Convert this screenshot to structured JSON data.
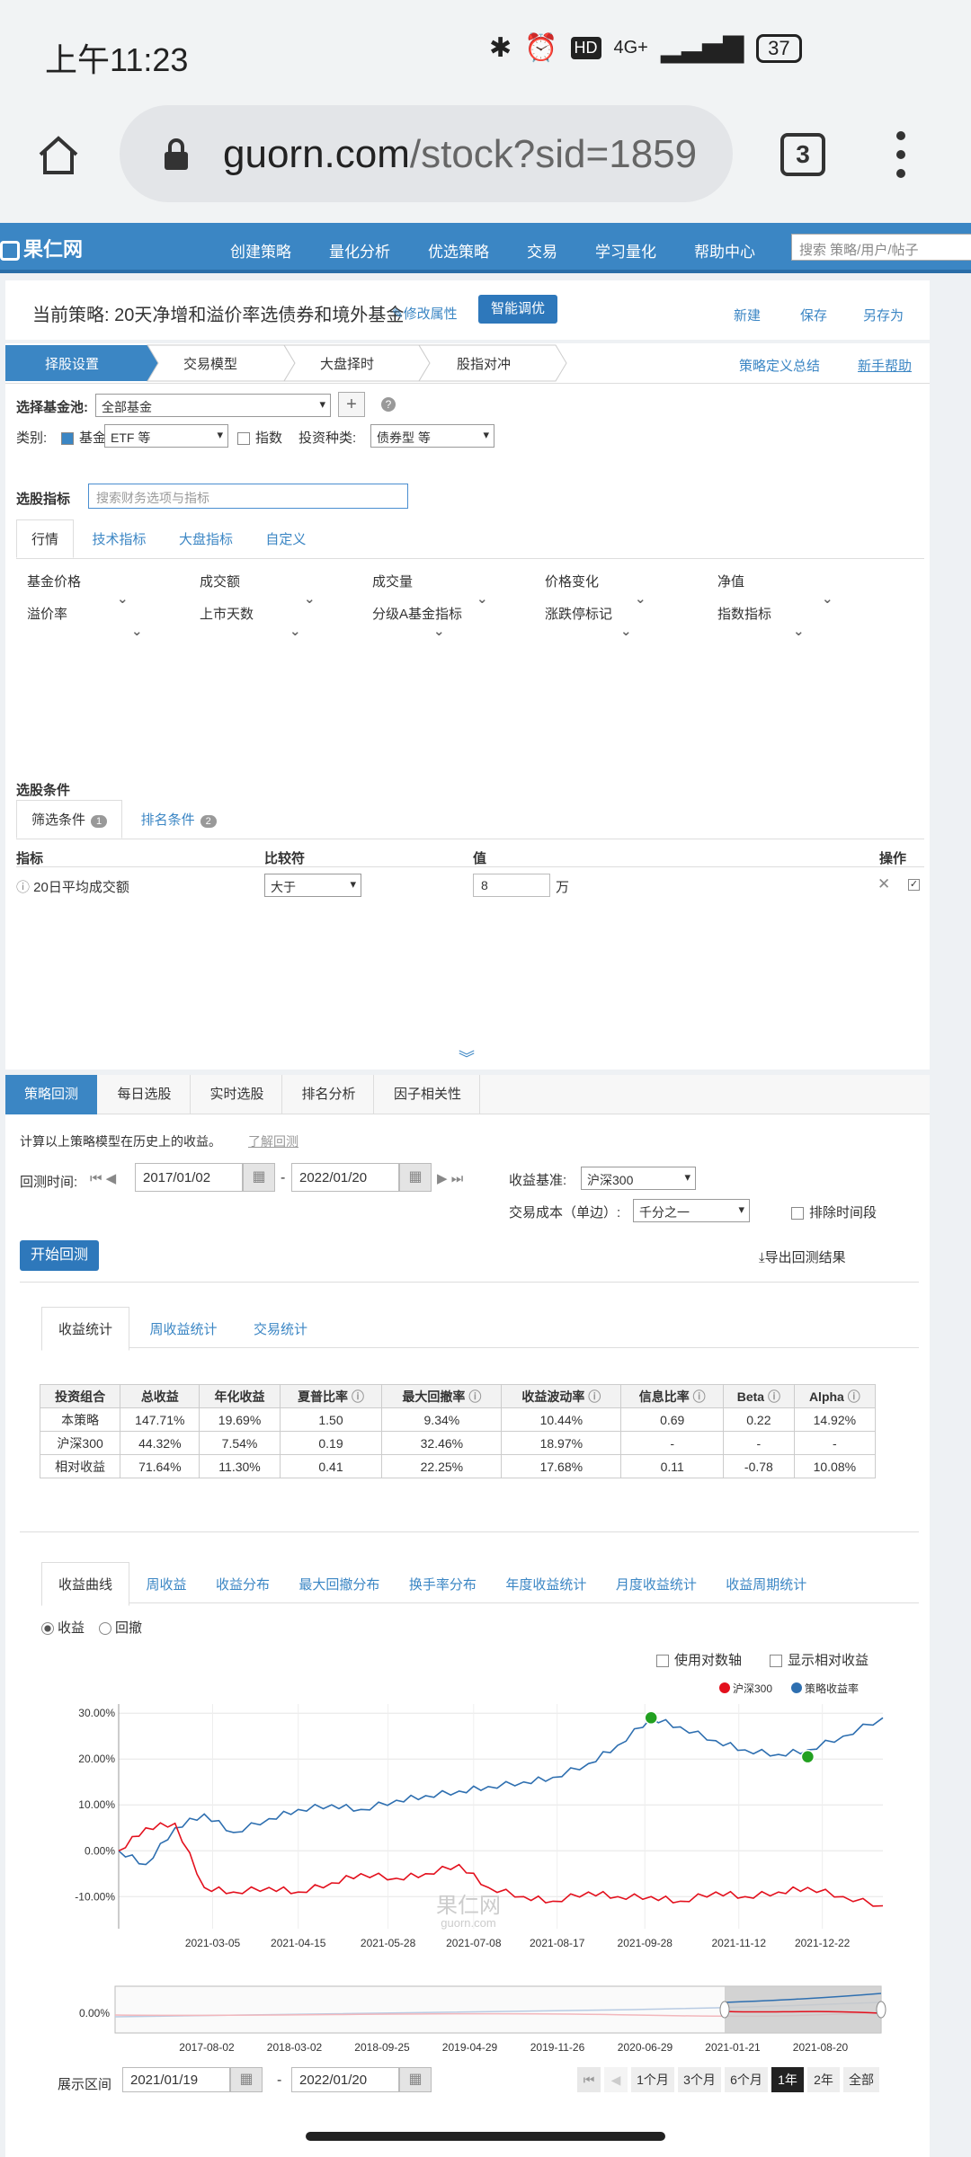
{
  "status_bar": {
    "time": "上午11:23",
    "network": "4G+",
    "battery": "37"
  },
  "browser": {
    "url_main": "guorn.com",
    "url_path": "/stock?sid=1859",
    "tab_count": "3"
  },
  "site": {
    "logo": "果仁网",
    "menu": [
      "创建策略",
      "量化分析",
      "优选策略",
      "交易",
      "学习量化",
      "帮助中心"
    ],
    "search_placeholder": "搜索 策略/用户/帖子"
  },
  "strategy": {
    "title": "当前策略: 20天净增和溢价率选债券和境外基金",
    "edit_label": "修改属性",
    "smart_button": "智能调优",
    "actions": [
      "新建",
      "保存",
      "另存为"
    ]
  },
  "steps": {
    "items": [
      "择股设置",
      "交易模型",
      "大盘择时",
      "股指对冲"
    ],
    "right_links": [
      "策略定义总结",
      "新手帮助"
    ]
  },
  "pool": {
    "label": "选择基金池:",
    "value": "全部基金",
    "category_label": "类别:",
    "fund_check": "基金",
    "fund_type": "ETF 等",
    "index_check": "指数",
    "invest_label": "投资种类:",
    "invest_value": "债券型 等"
  },
  "indicators": {
    "label": "选股指标",
    "search_placeholder": "搜索财务选项与指标",
    "tabs": [
      "行情",
      "技术指标",
      "大盘指标",
      "自定义"
    ],
    "row1": [
      "基金价格",
      "成交额",
      "成交量",
      "价格变化",
      "净值"
    ],
    "row2": [
      "溢价率",
      "上市天数",
      "分级A基金指标",
      "涨跌停标记",
      "指数指标"
    ]
  },
  "conditions": {
    "label": "选股条件",
    "tabs": [
      {
        "label": "筛选条件",
        "badge": "1"
      },
      {
        "label": "排名条件",
        "badge": "2"
      }
    ],
    "headers": [
      "指标",
      "比较符",
      "值",
      "操作"
    ],
    "row": {
      "name": "20日平均成交额",
      "operator": "大于",
      "value": "8",
      "unit": "万"
    }
  },
  "backtest_tabs": [
    "策略回测",
    "每日选股",
    "实时选股",
    "排名分析",
    "因子相关性"
  ],
  "backtest": {
    "intro": "计算以上策略模型在历史上的收益。",
    "learn": "了解回测",
    "time_label": "回测时间:",
    "start": "2017/01/02",
    "end": "2022/01/20",
    "bench_label": "收益基准:",
    "bench_value": "沪深300",
    "cost_label": "交易成本（单边）:",
    "cost_value": "千分之一",
    "exclude_label": "排除时间段",
    "run_button": "开始回测",
    "export_label": "导出回测结果"
  },
  "stats": {
    "tabs": [
      "收益统计",
      "周收益统计",
      "交易统计"
    ],
    "headers": [
      "投资组合",
      "总收益",
      "年化收益",
      "夏普比率",
      "最大回撤率",
      "收益波动率",
      "信息比率",
      "Beta",
      "Alpha"
    ],
    "rows": [
      [
        "本策略",
        "147.71%",
        "19.69%",
        "1.50",
        "9.34%",
        "10.44%",
        "0.69",
        "0.22",
        "14.92%"
      ],
      [
        "沪深300",
        "44.32%",
        "7.54%",
        "0.19",
        "32.46%",
        "18.97%",
        "-",
        "-",
        "-"
      ],
      [
        "相对收益",
        "71.64%",
        "11.30%",
        "0.41",
        "22.25%",
        "17.68%",
        "0.11",
        "-0.78",
        "10.08%"
      ]
    ]
  },
  "curve": {
    "tabs": [
      "收益曲线",
      "周收益",
      "收益分布",
      "最大回撤分布",
      "换手率分布",
      "年度收益统计",
      "月度收益统计",
      "收益周期统计"
    ],
    "radio": [
      "收益",
      "回撤"
    ],
    "options": [
      "使用对数轴",
      "显示相对收益"
    ],
    "range_label": "展示区间",
    "range_start": "2021/01/19",
    "range_end": "2022/01/20",
    "periods": [
      "1个月",
      "3个月",
      "6个月",
      "1年",
      "2年",
      "全部"
    ],
    "watermark": "果仁网",
    "watermark_sub": "guorn.com",
    "navigator_y_label": "0.00%",
    "navigator_x": [
      "2017-08-02",
      "2018-03-02",
      "2018-09-25",
      "2019-04-29",
      "2019-11-26",
      "2020-06-29",
      "2021-01-21",
      "2021-08-20"
    ]
  },
  "chart_data": {
    "type": "line",
    "legend": [
      "沪深300",
      "策略收益率"
    ],
    "colors": {
      "沪深300": "#e3101d",
      "策略收益率": "#2e6fb0"
    },
    "x_ticks": [
      "2021-03-05",
      "2021-04-15",
      "2021-05-28",
      "2021-07-08",
      "2021-08-17",
      "2021-09-28",
      "2021-11-12",
      "2021-12-22"
    ],
    "y_ticks": [
      "30.00%",
      "20.00%",
      "10.00%",
      "0.00%",
      "-10.00%"
    ],
    "ylim": [
      -17,
      32
    ],
    "x": [
      "2021-01-19",
      "2021-02-01",
      "2021-02-15",
      "2021-03-01",
      "2021-03-15",
      "2021-04-01",
      "2021-04-15",
      "2021-05-01",
      "2021-05-15",
      "2021-06-01",
      "2021-06-15",
      "2021-07-01",
      "2021-07-15",
      "2021-08-01",
      "2021-08-15",
      "2021-09-01",
      "2021-09-15",
      "2021-10-01",
      "2021-10-15",
      "2021-11-01",
      "2021-11-15",
      "2021-12-01",
      "2021-12-15",
      "2022-01-01",
      "2022-01-20"
    ],
    "series": [
      {
        "name": "策略收益率",
        "values": [
          0,
          -3,
          5,
          8,
          4,
          7,
          9,
          10,
          9,
          11,
          12,
          13,
          14,
          15,
          16,
          19,
          23,
          29,
          27,
          24,
          22,
          21,
          22,
          25,
          29
        ]
      },
      {
        "name": "沪深300",
        "values": [
          0,
          5,
          6,
          -8,
          -9,
          -8,
          -9,
          -7,
          -5,
          -6,
          -5,
          -3,
          -8,
          -10,
          -11,
          -9,
          -10,
          -10,
          -11,
          -9,
          -10,
          -9,
          -8,
          -10,
          -12
        ]
      }
    ],
    "markers": [
      {
        "series": "策略收益率",
        "x": "2021-10-01",
        "y": 29
      },
      {
        "series": "策略收益率",
        "x": "2021-12-15",
        "y": 20.5
      }
    ]
  }
}
